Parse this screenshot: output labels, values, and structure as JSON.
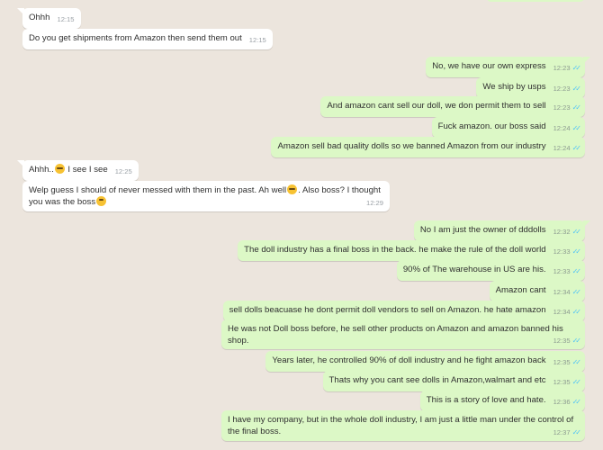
{
  "messages": [
    {
      "id": "m1",
      "dir": "in",
      "text": "Ohhh",
      "time": "12:15"
    },
    {
      "id": "m2",
      "dir": "in",
      "text": "Do you get shipments from Amazon then send them out",
      "time": "12:15"
    },
    {
      "id": "m3",
      "dir": "out",
      "text": "No, we have our own express",
      "time": "12:23"
    },
    {
      "id": "m4",
      "dir": "out",
      "text": "We ship by usps",
      "time": "12:23"
    },
    {
      "id": "m5",
      "dir": "out",
      "text": "And amazon cant sell our doll, we don permit them to sell",
      "time": "12:23"
    },
    {
      "id": "m6",
      "dir": "out",
      "text": "Fuck amazon. our boss said",
      "time": "12:24"
    },
    {
      "id": "m7",
      "dir": "out",
      "text": "Amazon sell bad quality dolls so we banned Amazon from our industry",
      "time": "12:24"
    },
    {
      "id": "m8",
      "dir": "in",
      "text_a": "Ahhh..",
      "text_b": " I see I see",
      "time": "12:25"
    },
    {
      "id": "m9",
      "dir": "in",
      "text_a": "Welp guess I should of never messed with them in the past. Ah well",
      "text_b": ". Also boss? I thought you was the boss",
      "time": "12:29"
    },
    {
      "id": "m10",
      "dir": "out",
      "text": "No I am just the owner of dddolls",
      "time": "12:32"
    },
    {
      "id": "m11",
      "dir": "out",
      "text": "The doll industry has a final boss in the back. he make the rule of the doll world",
      "time": "12:33"
    },
    {
      "id": "m12",
      "dir": "out",
      "text": "90% of The warehouse in US are his.",
      "time": "12:33"
    },
    {
      "id": "m13",
      "dir": "out",
      "text": "Amazon cant",
      "time": "12:34"
    },
    {
      "id": "m14",
      "dir": "out",
      "text": "sell dolls beacuase he dont permit doll vendors to sell on Amazon. he hate amazon",
      "time": "12:34"
    },
    {
      "id": "m15",
      "dir": "out",
      "text": "He was not Doll boss before, he sell other products on Amazon and amazon banned his shop.",
      "time": "12:35"
    },
    {
      "id": "m16",
      "dir": "out",
      "text": "Years later, he controlled 90% of doll industry and he fight amazon back",
      "time": "12:35"
    },
    {
      "id": "m17",
      "dir": "out",
      "text": "Thats why you cant see dolls in Amazon,walmart and etc",
      "time": "12:35"
    },
    {
      "id": "m18",
      "dir": "out",
      "text": "This is a story of love and hate.",
      "time": "12:36"
    },
    {
      "id": "m19",
      "dir": "out",
      "text": "I have my company, but in the whole doll industry, I am just a little man under the control of the final boss.",
      "time": "12:37"
    }
  ],
  "colors": {
    "incoming": "#ffffff",
    "outgoing": "#dcf8c6",
    "background": "#ece5dd",
    "read_check": "#4fc3f7"
  },
  "icons": {
    "read_receipt": "double-check-icon",
    "emoji_grin": "grinning-emoji-icon",
    "emoji_thinking": "thinking-emoji-icon"
  }
}
